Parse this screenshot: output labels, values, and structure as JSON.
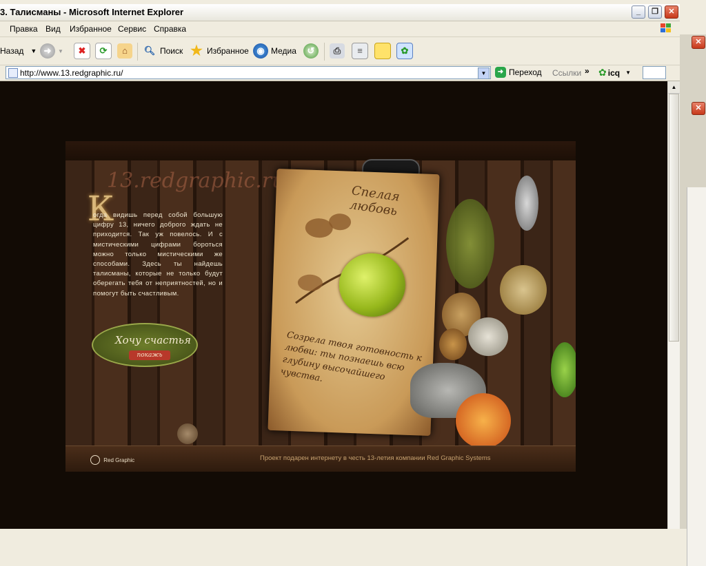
{
  "window": {
    "title": "3. Талисманы - Microsoft Internet Explorer"
  },
  "menu": {
    "items": [
      "Правка",
      "Вид",
      "Избранное",
      "Сервис",
      "Справка"
    ]
  },
  "toolbar": {
    "back_label": "Назад",
    "search_label": "Поиск",
    "favorites_label": "Избранное",
    "media_label": "Медиа"
  },
  "address": {
    "url": "http://www.13.redgraphic.ru/",
    "go_label": "Переход",
    "links_label": "Ссылки",
    "icq_label": "icq"
  },
  "page": {
    "logo_word": "13.redgraphic.ru",
    "dropcap": "К",
    "intro": "огда видишь перед собой большую цифру 13, ничего доброго ждать не приходится. Так уж повелось. И с мистическими цифрами бороться можно только мистическими же способами. Здесь ты найдешь талисманы, которые не только будут оберегать тебя от неприятностей, но и помогут быть счастливым.",
    "cta_label": "Хочу счастья",
    "cta_ribbon": "покажь",
    "card_title": "Спелая любовь",
    "card_text": "Созрела твоя готовность к любви: ты познаешь всю глубину высочайшего чувства.",
    "footer_logo": "Red Graphic",
    "footer_text": "Проект подарен интернету в честь 13-летия компании Red Graphic Systems"
  },
  "colors": {
    "page_bg": "#120b05",
    "accent": "#c6a06f",
    "chrome": "#f0ecdf"
  }
}
